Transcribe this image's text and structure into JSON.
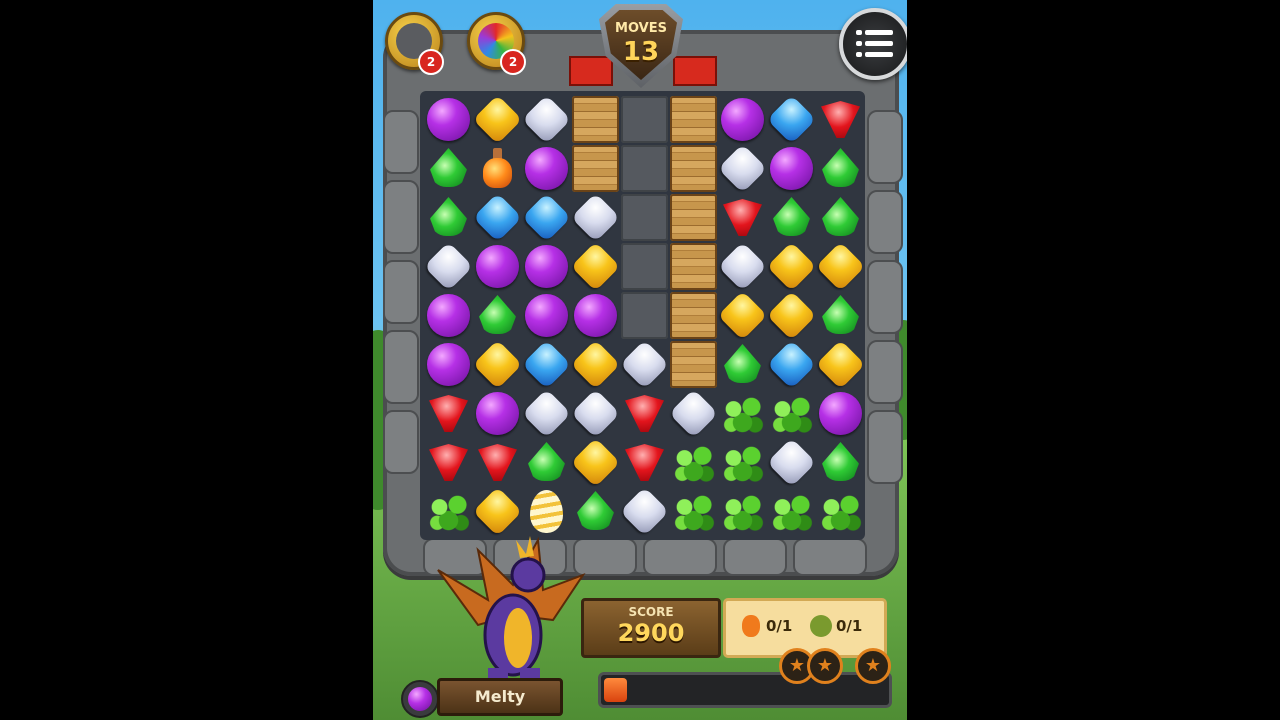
{
  "hud": {
    "moves_label": "MOVES",
    "moves_value": "13",
    "booster_1_count": "2",
    "booster_2_count": "2",
    "menu_icon": "hamburger-menu-icon"
  },
  "board": {
    "rows": [
      [
        "purple",
        "yellow",
        "white",
        "crate",
        "block",
        "crate",
        "purple",
        "blue",
        "red"
      ],
      [
        "green",
        "potion",
        "purple",
        "crate",
        "block",
        "crate",
        "white",
        "purple",
        "green"
      ],
      [
        "green",
        "blue",
        "blue",
        "white",
        "block",
        "crate",
        "red",
        "green",
        "green"
      ],
      [
        "white",
        "purple",
        "purple",
        "yellow",
        "block",
        "crate",
        "white",
        "yellow",
        "yellow"
      ],
      [
        "purple",
        "green",
        "purple",
        "purple",
        "block",
        "crate",
        "yellow",
        "yellow",
        "green"
      ],
      [
        "purple",
        "yellow",
        "blue",
        "yellow",
        "white",
        "crate",
        "green",
        "blue",
        "yellow"
      ],
      [
        "red",
        "purple",
        "white",
        "white",
        "red",
        "white",
        "vine",
        "vine",
        "purple"
      ],
      [
        "red",
        "red",
        "green",
        "yellow",
        "red",
        "vine",
        "vine",
        "white",
        "green"
      ],
      [
        "vine",
        "yellow",
        "egg",
        "green",
        "white",
        "vine",
        "vine",
        "vine",
        "vine"
      ]
    ]
  },
  "bottom": {
    "score_label": "SCORE",
    "score_value": "2900",
    "goal_1": "0/1",
    "goal_2": "0/1",
    "character_name": "Melty",
    "progress_fraction": 0.08,
    "stars_earned": 0,
    "stars_total": 3
  },
  "colors": {
    "sky": "#4fb2ee",
    "accent": "#e0811d",
    "score_text": "#ffd75c"
  }
}
